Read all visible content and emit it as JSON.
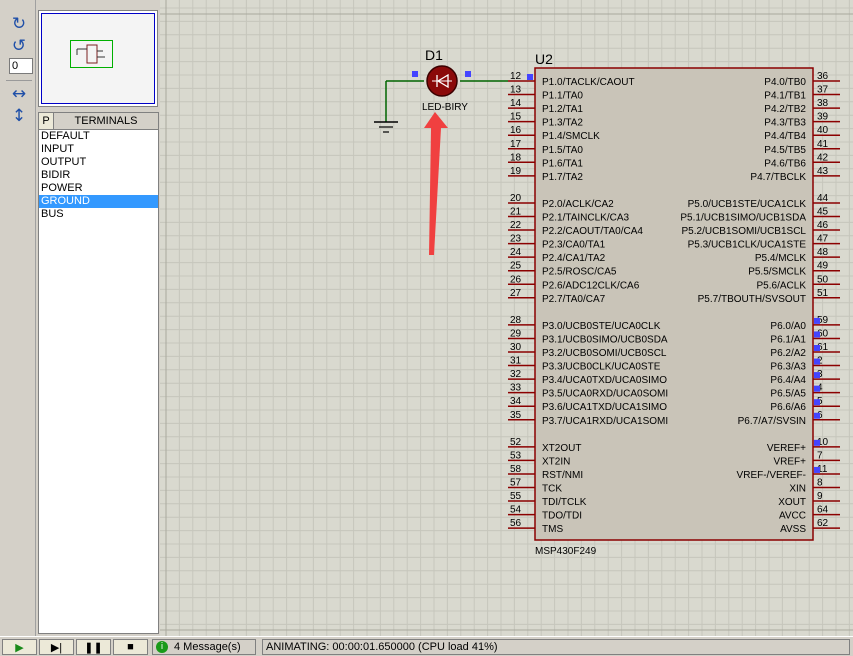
{
  "toolbar": {
    "rotate_cw_glyph": "↻",
    "rotate_ccw_glyph": "↺",
    "rotation_value": "0",
    "mirror_h_glyph": "↔",
    "mirror_v_glyph": "↕"
  },
  "picker": {
    "p_button": "P",
    "title": "TERMINALS",
    "items": [
      "DEFAULT",
      "INPUT",
      "OUTPUT",
      "BIDIR",
      "POWER",
      "GROUND",
      "BUS"
    ],
    "selected": "GROUND"
  },
  "schematic": {
    "led": {
      "ref": "D1",
      "value": "LED-BIRY"
    },
    "mcu": {
      "ref": "U2",
      "part": "MSP430F249",
      "left_pins": [
        {
          "num": "12",
          "label": "P1.0/TACLK/CAOUT",
          "state": "high"
        },
        {
          "num": "13",
          "label": "P1.1/TA0"
        },
        {
          "num": "14",
          "label": "P1.2/TA1"
        },
        {
          "num": "15",
          "label": "P1.3/TA2"
        },
        {
          "num": "16",
          "label": "P1.4/SMCLK"
        },
        {
          "num": "17",
          "label": "P1.5/TA0"
        },
        {
          "num": "18",
          "label": "P1.6/TA1"
        },
        {
          "num": "19",
          "label": "P1.7/TA2"
        },
        {
          "num": "20",
          "label": "P2.0/ACLK/CA2"
        },
        {
          "num": "21",
          "label": "P2.1/TAINCLK/CA3"
        },
        {
          "num": "22",
          "label": "P2.2/CAOUT/TA0/CA4"
        },
        {
          "num": "23",
          "label": "P2.3/CA0/TA1"
        },
        {
          "num": "24",
          "label": "P2.4/CA1/TA2"
        },
        {
          "num": "25",
          "label": "P2.5/ROSC/CA5"
        },
        {
          "num": "26",
          "label": "P2.6/ADC12CLK/CA6"
        },
        {
          "num": "27",
          "label": "P2.7/TA0/CA7"
        },
        {
          "num": "28",
          "label": "P3.0/UCB0STE/UCA0CLK"
        },
        {
          "num": "29",
          "label": "P3.1/UCB0SIMO/UCB0SDA"
        },
        {
          "num": "30",
          "label": "P3.2/UCB0SOMI/UCB0SCL"
        },
        {
          "num": "31",
          "label": "P3.3/UCB0CLK/UCA0STE"
        },
        {
          "num": "32",
          "label": "P3.4/UCA0TXD/UCA0SIMO"
        },
        {
          "num": "33",
          "label": "P3.5/UCA0RXD/UCA0SOMI"
        },
        {
          "num": "34",
          "label": "P3.6/UCA1TXD/UCA1SIMO"
        },
        {
          "num": "35",
          "label": "P3.7/UCA1RXD/UCA1SOMI"
        },
        {
          "num": "52",
          "label": "XT2OUT"
        },
        {
          "num": "53",
          "label": "XT2IN"
        },
        {
          "num": "58",
          "label": "RST/NMI"
        },
        {
          "num": "57",
          "label": "TCK"
        },
        {
          "num": "55",
          "label": "TDI/TCLK"
        },
        {
          "num": "54",
          "label": "TDO/TDI"
        },
        {
          "num": "56",
          "label": "TMS"
        }
      ],
      "right_pins": [
        {
          "num": "36",
          "label": "P4.0/TB0"
        },
        {
          "num": "37",
          "label": "P4.1/TB1"
        },
        {
          "num": "38",
          "label": "P4.2/TB2"
        },
        {
          "num": "39",
          "label": "P4.3/TB3"
        },
        {
          "num": "40",
          "label": "P4.4/TB4"
        },
        {
          "num": "41",
          "label": "P4.5/TB5"
        },
        {
          "num": "42",
          "label": "P4.6/TB6"
        },
        {
          "num": "43",
          "label": "P4.7/TBCLK"
        },
        {
          "num": "44",
          "label": "P5.0/UCB1STE/UCA1CLK"
        },
        {
          "num": "45",
          "label": "P5.1/UCB1SIMO/UCB1SDA"
        },
        {
          "num": "46",
          "label": "P5.2/UCB1SOMI/UCB1SCL"
        },
        {
          "num": "47",
          "label": "P5.3/UCB1CLK/UCA1STE"
        },
        {
          "num": "48",
          "label": "P5.4/MCLK"
        },
        {
          "num": "49",
          "label": "P5.5/SMCLK"
        },
        {
          "num": "50",
          "label": "P5.6/ACLK"
        },
        {
          "num": "51",
          "label": "P5.7/TBOUTH/SVSOUT"
        },
        {
          "num": "59",
          "label": "P6.0/A0",
          "state": "high"
        },
        {
          "num": "60",
          "label": "P6.1/A1",
          "state": "high"
        },
        {
          "num": "61",
          "label": "P6.2/A2",
          "state": "high"
        },
        {
          "num": "2",
          "label": "P6.3/A3",
          "state": "high"
        },
        {
          "num": "3",
          "label": "P6.4/A4",
          "state": "high"
        },
        {
          "num": "4",
          "label": "P6.5/A5",
          "state": "high"
        },
        {
          "num": "5",
          "label": "P6.6/A6",
          "state": "high"
        },
        {
          "num": "6",
          "label": "P6.7/A7/SVSIN",
          "state": "high"
        },
        {
          "num": "10",
          "label": "VEREF+",
          "state": "high"
        },
        {
          "num": "7",
          "label": "VREF+"
        },
        {
          "num": "11",
          "label": "VREF-/VEREF-",
          "state": "high"
        },
        {
          "num": "8",
          "label": "XIN"
        },
        {
          "num": "9",
          "label": "XOUT"
        },
        {
          "num": "64",
          "label": "AVCC"
        },
        {
          "num": "62",
          "label": "AVSS"
        }
      ]
    }
  },
  "status": {
    "play": "▶",
    "step": "▶|",
    "pause": "❚❚",
    "stop": "■",
    "message_icon": "i",
    "messages": "4 Message(s)",
    "sim_state": "ANIMATING: 00:00:01.650000 (CPU load 41%)"
  },
  "colors": {
    "component_body": "#c9c4b8",
    "component_outline": "#8b0000",
    "wire": "#006400",
    "pin_high": "#4444ff",
    "annotation_arrow": "#f04040",
    "grid": "#c6c6bc"
  }
}
